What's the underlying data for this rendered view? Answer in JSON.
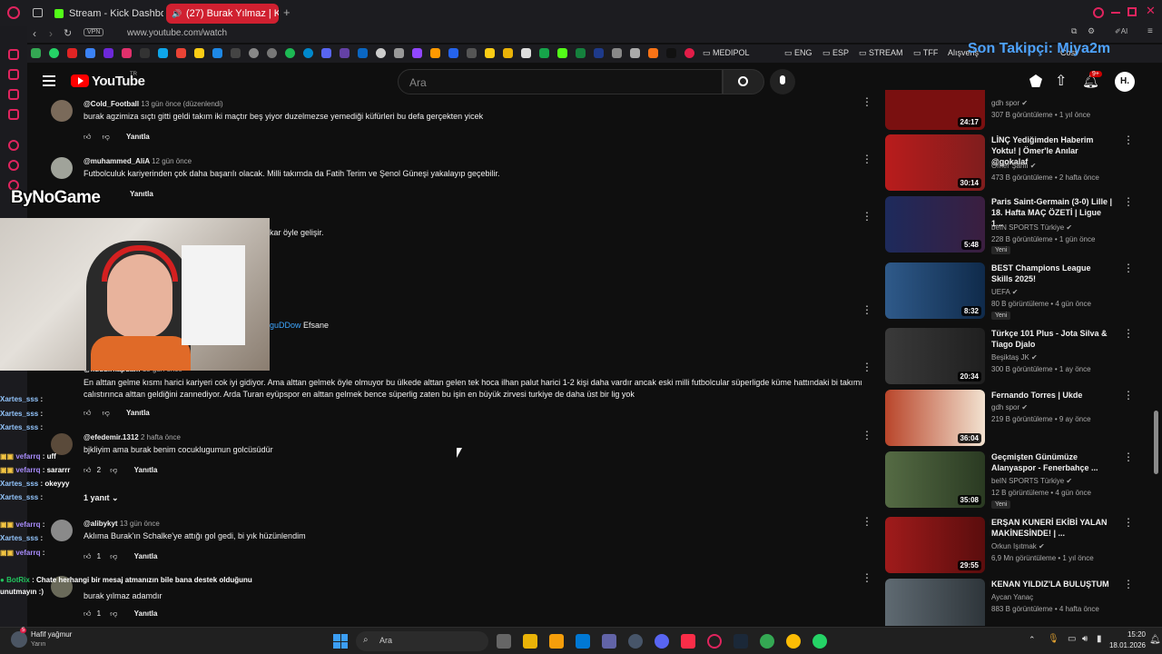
{
  "browser": {
    "tabs": [
      {
        "label": "Stream - Kick Dashboard",
        "active": false
      },
      {
        "label": "(27) Burak Yılmaz | Kra",
        "active": true
      }
    ],
    "vpn_label": "VPN",
    "url": "www.youtube.com/watch",
    "bookmarks": [
      "MEDIPOL",
      "ENG",
      "ESP",
      "STREAM",
      "TFF",
      "Alışveriş"
    ],
    "bookmark_tail": "Cost"
  },
  "overlay": {
    "follower_text": "Son Takipçi: Miya2m",
    "brand_logo": "ByNoGame",
    "stream_colors": {
      "accent": "#4ea3ff",
      "kick_green": "#53fc18"
    }
  },
  "youtube": {
    "logo_text": "YouTube",
    "logo_suffix": "TR",
    "search_placeholder": "Ara",
    "notification_count": "9+",
    "account_initial": "H."
  },
  "comments": [
    {
      "author": "@Cold_Football",
      "time": "13 gün önce (düzenlendi)",
      "text": "burak agzimiza sıçtı gitti geldi takım iki maçtır beş yiyor duzelmezse yemediği küfürleri bu defa gerçekten yicek",
      "likes": "",
      "reply_label": "Yanıtla"
    },
    {
      "author": "@muhammed_AliA",
      "time": "12 gün önce",
      "text": "Futbolculuk kariyerinden çok daha başarılı olacak. Milli takımda da Fatih Terim ve Şenol Güneşi yakalayıp geçebilir.",
      "likes": "",
      "reply_label": "Yanıtla"
    },
    {
      "author": "",
      "time": "",
      "text": "kar öyle gelişir.",
      "likes": "",
      "reply_label": ""
    },
    {
      "author": "",
      "time": "",
      "text": "Efsane",
      "mention": "guDDow",
      "likes": "",
      "reply_label": ""
    },
    {
      "author": "@kuduirkapdam",
      "time": "13 gün önce",
      "text": "En alttan gelme kısmı harici kariyeri cok iyi gidiyor. Ama alttan gelmek öyle olmuyor bu ülkede alttan gelen tek hoca ilhan palut harici 1-2 kişi daha vardır ancak eski milli futbolcular süperligde küme hattındaki bi takımı calıstırınca alttan geldiğini zannediyor. Arda Turan eyüpspor en alttan gelmek bence süperlig zaten bu işin en büyük zirvesi turkiye de daha üst bir lig yok",
      "likes": "",
      "reply_label": "Yanıtla"
    },
    {
      "author": "@efedemir.1312",
      "time": "2 hafta önce",
      "text": "bjkliyim ama burak benim cocuklugumun golcüsüdür",
      "likes": "2",
      "reply_label": "Yanıtla",
      "replies": "1 yanıt"
    },
    {
      "author": "@alibykyt",
      "time": "13 gün önce",
      "text": "Aklıma Burak'ın Schalke'ye attığı gol gedi, bi yık hüzünlendim",
      "likes": "1",
      "reply_label": "Yanıtla"
    },
    {
      "author": "",
      "time": "",
      "text": "burak yılmaz adamdır",
      "likes": "1",
      "reply_label": "Yanıtla"
    }
  ],
  "chat": [
    {
      "user": "Xartes_sss",
      "message": ""
    },
    {
      "user": "Xartes_sss",
      "message": ""
    },
    {
      "user": "Xartes_sss",
      "message": ""
    },
    {
      "user": "vefarrq",
      "message": "uff"
    },
    {
      "user": "vefarrq",
      "message": "sararrr"
    },
    {
      "user": "Xartes_sss",
      "message": "okeyyy"
    },
    {
      "user": "Xartes_sss",
      "message": ""
    },
    {
      "user": "vefarrq",
      "message": ""
    },
    {
      "user": "Xartes_sss",
      "message": ""
    },
    {
      "user": "vefarrq",
      "message": ""
    },
    {
      "user": "BotRix",
      "message": "Chate herhangi bir mesaj atmanızın bile bana destek olduğunu",
      "cont": "unutmayın :)"
    }
  ],
  "sidebar": [
    {
      "title": "",
      "channel": "gdh spor",
      "meta": "307 B görüntüleme • 1 yıl önce",
      "duration": "24:17",
      "badge": "",
      "thumb_color": "#7a1010"
    },
    {
      "title": "LİNÇ Yediğimden Haberim Yoktu! | Ömer'le Anılar @gokalaf",
      "channel": "Ömer Şanlı",
      "meta": "473 B görüntüleme • 2 hafta önce",
      "duration": "30:14",
      "badge": "",
      "thumb_color": "#9b1420"
    },
    {
      "title": "Paris Saint-Germain (3-0) Lille | 18. Hafta MAÇ ÖZETİ | Ligue 1...",
      "channel": "beIN SPORTS Türkiye",
      "meta": "228 B görüntüleme • 1 gün önce",
      "duration": "5:48",
      "badge": "Yeni",
      "thumb_color": "#1d2a5c"
    },
    {
      "title": "BEST Champions League Skills 2025!",
      "channel": "UEFA",
      "meta": "80 B görüntüleme • 4 gün önce",
      "duration": "8:32",
      "badge": "Yeni",
      "thumb_color": "#2f5a8a"
    },
    {
      "title": "Türkçe 101 Plus - Jota Silva & Tiago Djalo",
      "channel": "Beşiktaş JK",
      "meta": "300 B görüntüleme • 1 ay önce",
      "duration": "20:34",
      "badge": "",
      "thumb_color": "#3a3a3a"
    },
    {
      "title": "Fernando Torres | Ukde",
      "channel": "gdh spor",
      "meta": "219 B görüntüleme • 9 ay önce",
      "duration": "36:04",
      "badge": "",
      "thumb_color": "#b9452a"
    },
    {
      "title": "Geçmişten Günümüze Alanyaspor - Fenerbahçe ...",
      "channel": "beIN SPORTS Türkiye",
      "meta": "12 B görüntüleme • 4 gün önce",
      "duration": "35:08",
      "badge": "Yeni",
      "thumb_color": "#556b44"
    },
    {
      "title": "ERŞAN KUNERİ EKİBİ YALAN MAKİNESİNDE! | ...",
      "channel": "Orkun Işıtmak",
      "meta": "6,9 Mn görüntüleme • 1 yıl önce",
      "duration": "29:55",
      "badge": "",
      "thumb_color": "#a01b1b"
    },
    {
      "title": "KENAN YILDIZ'LA BULUŞTUM",
      "channel": "Aycan Yanaç",
      "meta": "883 B görüntüleme • 4 hafta önce",
      "duration": "",
      "badge": "",
      "thumb_color": "#5f6a72"
    }
  ],
  "taskbar": {
    "weather_title": "Hafif yağmur",
    "weather_sub": "Yarın",
    "search_placeholder": "Ara",
    "time": "15:20",
    "date": "18.01.2026"
  }
}
